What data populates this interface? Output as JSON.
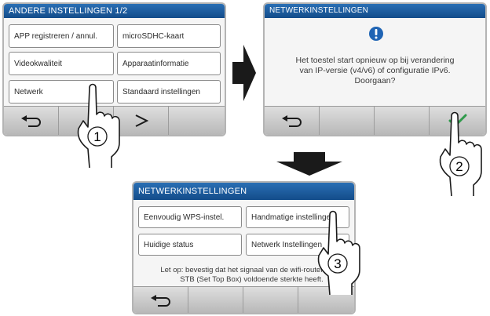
{
  "screen1": {
    "title": "ANDERE INSTELLINGEN 1/2",
    "buttons": [
      "APP registreren / annul.",
      "microSDHC-kaart",
      "Videokwaliteit",
      "Apparaatinformatie",
      "Netwerk",
      "Standaard instellingen"
    ],
    "back_icon": "return-arrow-icon",
    "next_icon": "chevron-right-icon"
  },
  "screen2": {
    "title": "NETWERKINSTELLINGEN",
    "alert_icon": "exclamation-circle-icon",
    "message": [
      "Het toestel start opnieuw op bij verandering",
      "van IP-versie (v4/v6) of configuratie IPv6.",
      "Doorgaan?"
    ],
    "back_icon": "return-arrow-icon",
    "confirm_icon": "checkmark-icon"
  },
  "screen3": {
    "title": "NETWERKINSTELLINGEN",
    "buttons": [
      "Eenvoudig WPS-instel.",
      "Handmatige instellingen",
      "Huidige status",
      "Netwerk Instellingen"
    ],
    "note": [
      "Let op: bevestig dat het signaal van de wifi-router /",
      "STB (Set Top Box) voldoende sterkte heeft."
    ],
    "back_icon": "return-arrow-icon"
  },
  "steps": [
    "1",
    "2",
    "3"
  ],
  "arrows": [
    "right-arrow-icon",
    "down-arrow-icon"
  ],
  "colors": {
    "titlebar": "#1e5fa3",
    "body": "#f5f5f5",
    "bar": "#c8c8c8",
    "check": "#2e9a4a",
    "alert": "#1f64b4"
  }
}
